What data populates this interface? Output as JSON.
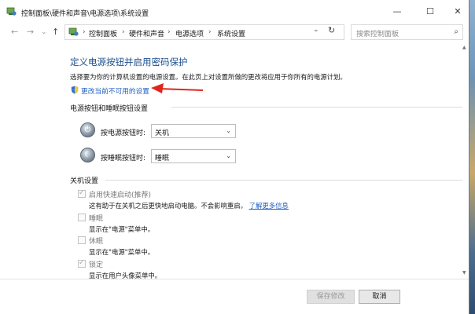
{
  "window": {
    "title": "控制面板\\硬件和声音\\电源选项\\系统设置",
    "minimize_glyph": "—",
    "maximize_glyph": "☐",
    "close_glyph": "✕"
  },
  "nav": {
    "back_glyph": "←",
    "forward_glyph": "→",
    "recent_glyph": "⌄",
    "up_glyph": "↑",
    "breadcrumbs": [
      "控制面板",
      "硬件和声音",
      "电源选项",
      "系统设置"
    ],
    "crumb_separator": "›",
    "address_chevron": "⌄",
    "refresh_glyph": "↻",
    "search_placeholder": "搜索控制面板",
    "search_glyph": "⌕"
  },
  "scroll": {
    "up_glyph": "▲",
    "down_glyph": "▼"
  },
  "main": {
    "title": "定义电源按钮并启用密码保护",
    "description": "选择要为你的计算机设置的电源设置。在此页上对设置所做的更改将应用于你所有的电源计划。",
    "change_settings_link": "更改当前不可用的设置",
    "power_section": {
      "heading": "电源按钮和睡眠按钮设置",
      "power_icon_glyph": "⏻",
      "sleep_icon_glyph": "☾",
      "power_button_label": "按电源按钮时:",
      "power_button_value": "关机",
      "sleep_button_label": "按睡眠按钮时:",
      "sleep_button_value": "睡眠",
      "select_chevron": "⌄"
    },
    "shutdown_section": {
      "heading": "关机设置",
      "check_glyph": "✓",
      "items": [
        {
          "label": "启用快速启动(推荐)",
          "checked": true,
          "desc": "这有助于在关机之后更快地启动电脑。不会影响重启。",
          "link": "了解更多信息"
        },
        {
          "label": "睡眠",
          "checked": false,
          "desc": "显示在\"电源\"菜单中。"
        },
        {
          "label": "休眠",
          "checked": false,
          "desc": "显示在\"电源\"菜单中。"
        },
        {
          "label": "锁定",
          "checked": true,
          "desc": "显示在用户头像菜单中。"
        }
      ]
    }
  },
  "footer": {
    "save_label": "保存修改",
    "cancel_label": "取消"
  },
  "colors": {
    "title_blue": "#1c4f8e",
    "link_blue": "#1f5fc0",
    "annotation_red": "#e0261c"
  }
}
